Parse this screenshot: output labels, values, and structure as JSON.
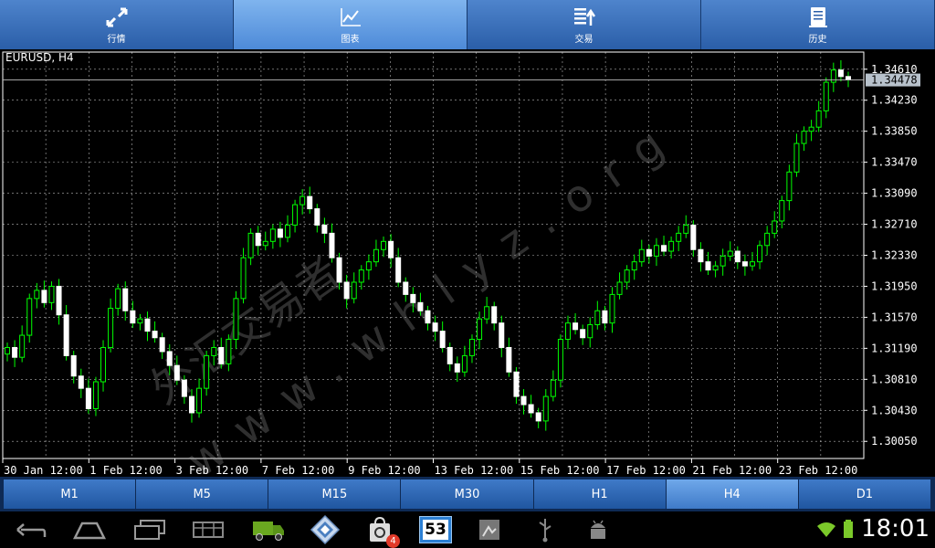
{
  "tabs": [
    {
      "label": "行情",
      "icon": "expand-arrows-icon",
      "active": false
    },
    {
      "label": "图表",
      "icon": "line-chart-icon",
      "active": true
    },
    {
      "label": "交易",
      "icon": "trade-list-icon",
      "active": false
    },
    {
      "label": "历史",
      "icon": "history-doc-icon",
      "active": false
    }
  ],
  "chart": {
    "symbol_title": "EURUSD, H4",
    "current_price": "1.34478",
    "price_ticks": [
      "1.34610",
      "1.34230",
      "1.33850",
      "1.33470",
      "1.33090",
      "1.32710",
      "1.32330",
      "1.31950",
      "1.31570",
      "1.31190",
      "1.30810",
      "1.30430",
      "1.30050"
    ],
    "date_ticks": [
      "30 Jan 12:00",
      "1 Feb 12:00",
      "3 Feb 12:00",
      "7 Feb 12:00",
      "9 Feb 12:00",
      "13 Feb 12:00",
      "15 Feb 12:00",
      "17 Feb 12:00",
      "21 Feb 12:00",
      "23 Feb 12:00"
    ],
    "watermark": "www.whlyz.org",
    "watermark_cn": "外汇交易者",
    "colors": {
      "bull": "#ffffff",
      "bear": "#00ff00",
      "wick": "#00ff00",
      "grid": "#ffffff",
      "axis": "#ffffff"
    }
  },
  "timeframes": [
    {
      "label": "M1",
      "active": false
    },
    {
      "label": "M5",
      "active": false
    },
    {
      "label": "M15",
      "active": false
    },
    {
      "label": "M30",
      "active": false
    },
    {
      "label": "H1",
      "active": false
    },
    {
      "label": "H4",
      "active": true
    },
    {
      "label": "D1",
      "active": false
    }
  ],
  "system": {
    "clock": "18:01",
    "calendar_day": "53",
    "notification_count": "4"
  },
  "chart_data": {
    "type": "candlestick",
    "title": "EURUSD, H4",
    "ylim": [
      1.2984,
      1.3482
    ],
    "x": [
      "30 Jan 12:00",
      "1 Feb 12:00",
      "3 Feb 12:00",
      "7 Feb 12:00",
      "9 Feb 12:00",
      "13 Feb 12:00",
      "15 Feb 12:00",
      "17 Feb 12:00",
      "21 Feb 12:00",
      "23 Feb 12:00"
    ],
    "closes": [
      1.312,
      1.3108,
      1.3135,
      1.318,
      1.319,
      1.3175,
      1.3195,
      1.316,
      1.311,
      1.3085,
      1.307,
      1.3045,
      1.3078,
      1.312,
      1.3168,
      1.3192,
      1.3165,
      1.315,
      1.3155,
      1.314,
      1.3132,
      1.3115,
      1.3098,
      1.308,
      1.306,
      1.304,
      1.307,
      1.311,
      1.312,
      1.31,
      1.313,
      1.318,
      1.323,
      1.326,
      1.3245,
      1.325,
      1.3265,
      1.3255,
      1.327,
      1.3295,
      1.3305,
      1.329,
      1.327,
      1.326,
      1.323,
      1.32,
      1.318,
      1.32,
      1.3215,
      1.3225,
      1.324,
      1.325,
      1.323,
      1.32,
      1.3185,
      1.3175,
      1.3165,
      1.315,
      1.314,
      1.312,
      1.31,
      1.309,
      1.311,
      1.313,
      1.3155,
      1.317,
      1.315,
      1.312,
      1.309,
      1.306,
      1.305,
      1.304,
      1.303,
      1.306,
      1.308,
      1.313,
      1.315,
      1.3142,
      1.3132,
      1.3148,
      1.3165,
      1.315,
      1.3185,
      1.32,
      1.3215,
      1.3225,
      1.324,
      1.3232,
      1.3245,
      1.3238,
      1.325,
      1.326,
      1.327,
      1.324,
      1.3225,
      1.3215,
      1.322,
      1.3232,
      1.3238,
      1.3225,
      1.322,
      1.3225,
      1.3245,
      1.326,
      1.3275,
      1.33,
      1.3335,
      1.337,
      1.3385,
      1.339,
      1.341,
      1.3445,
      1.346,
      1.3452,
      1.3448
    ]
  }
}
